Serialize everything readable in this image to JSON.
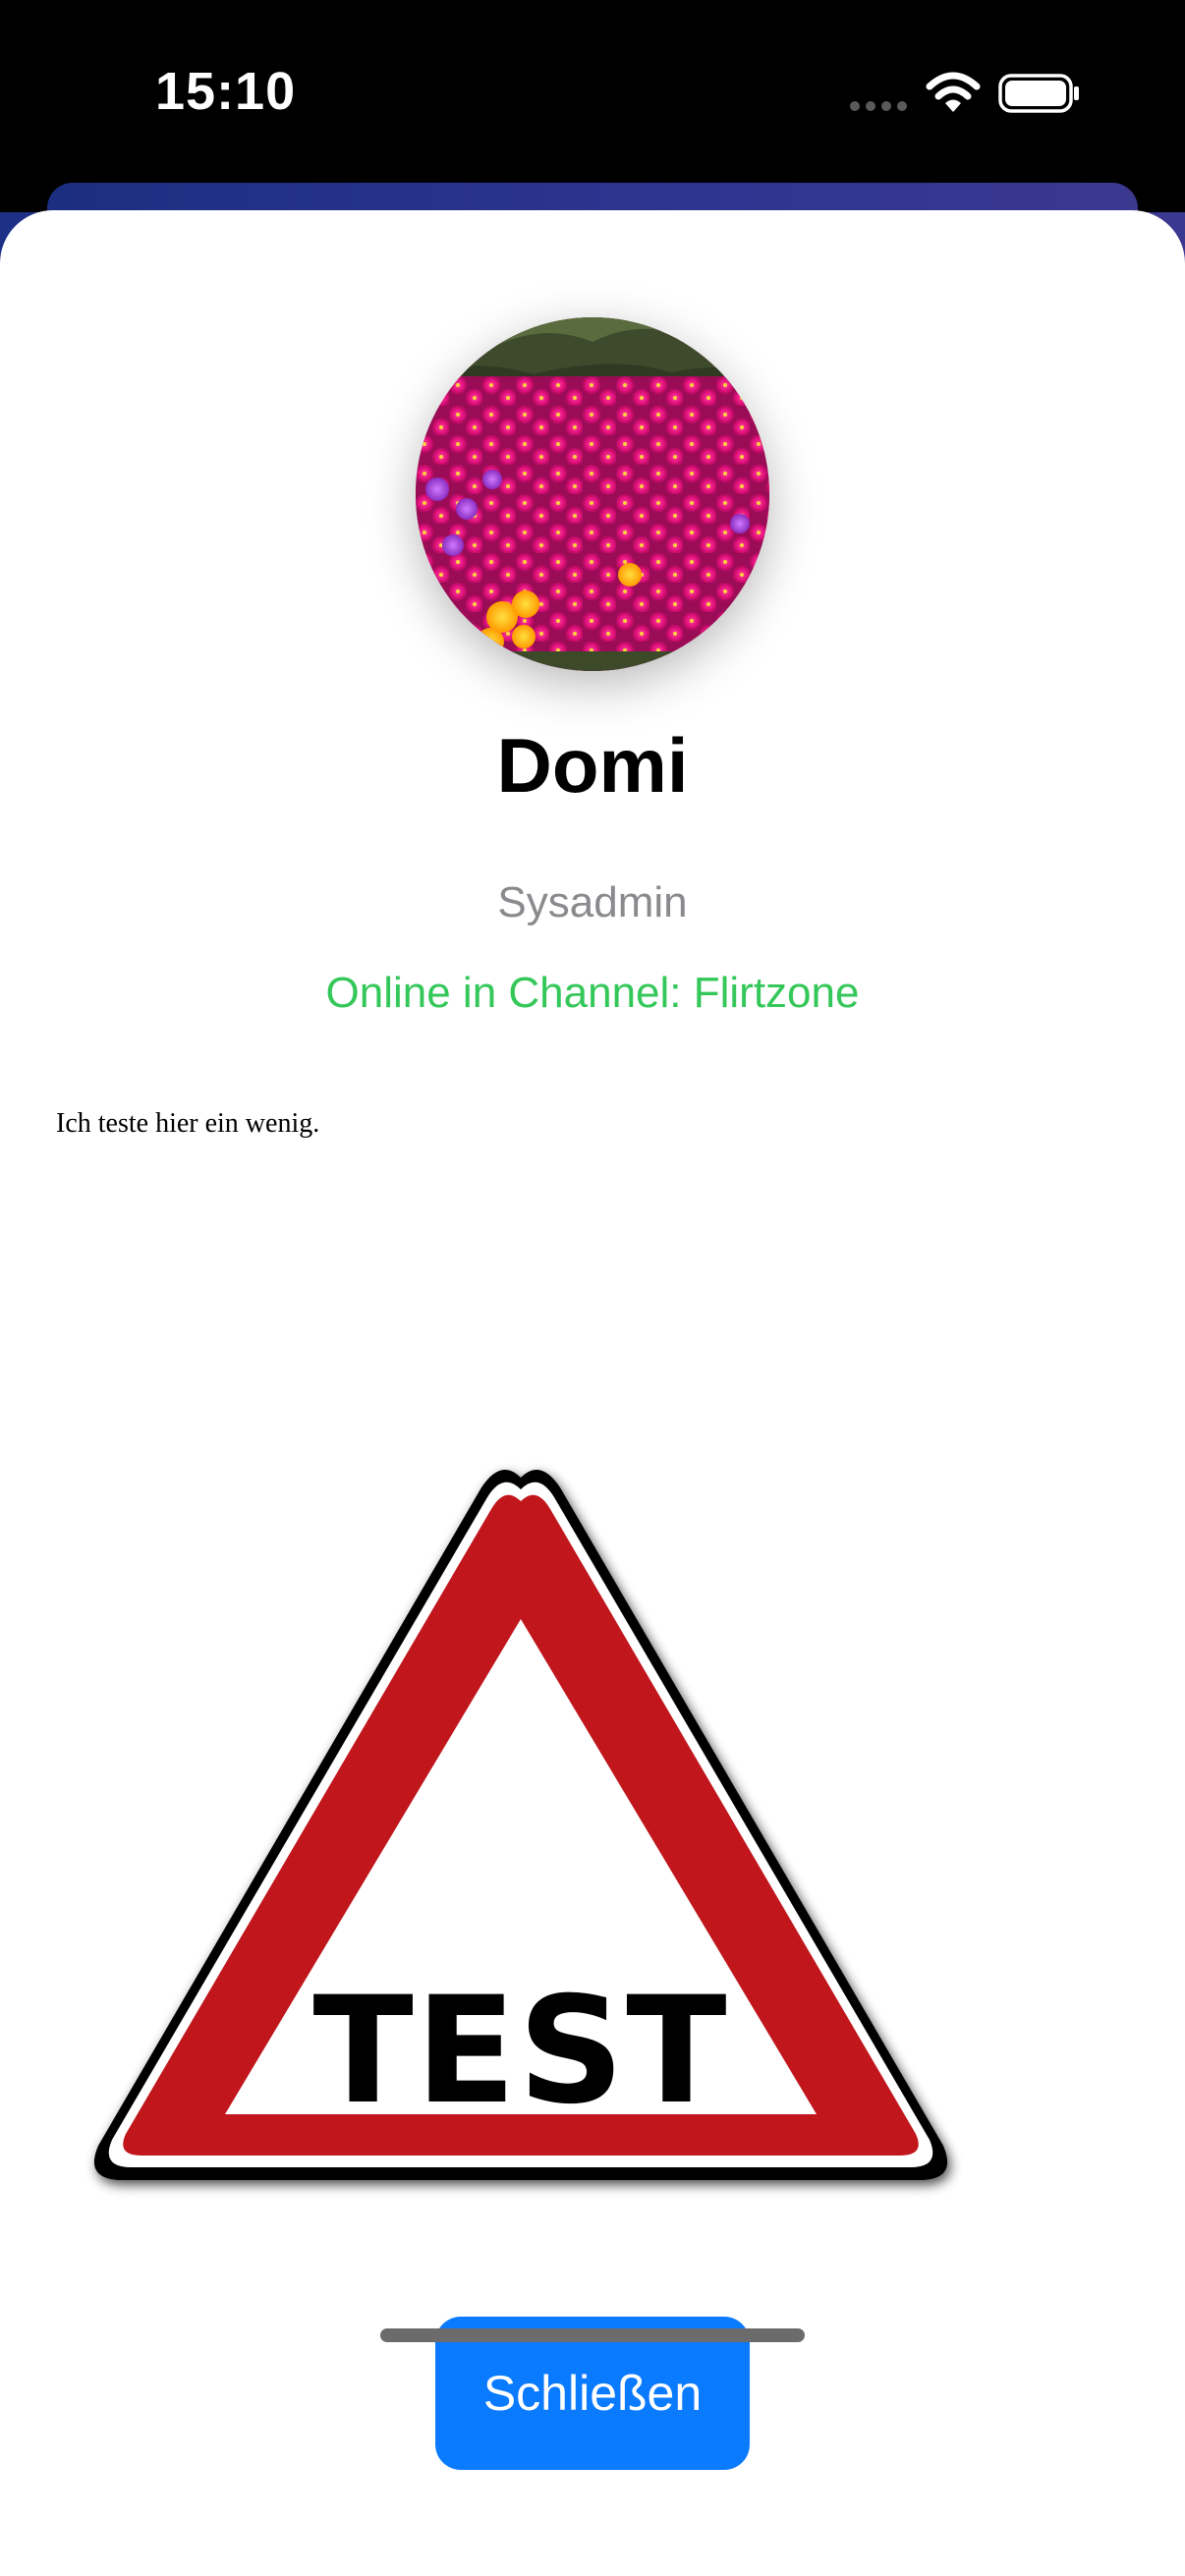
{
  "status_bar": {
    "time": "15:10",
    "icons": [
      "cellular-signal-icon",
      "wifi-icon",
      "battery-icon"
    ]
  },
  "profile": {
    "name": "Domi",
    "role": "Sysadmin",
    "status": "Online in Channel: Flirtzone",
    "bio": "Ich teste hier ein wenig.",
    "avatar": "profile-photo-flowers"
  },
  "image": {
    "sign_text": "TEST",
    "type": "warning-triangle-sign"
  },
  "actions": {
    "close_label": "Schließen"
  },
  "colors": {
    "accent": "#0a7aff",
    "status_online": "#34c759",
    "secondary_text": "#8a8a8e",
    "sign_red": "#c0141c",
    "header_gradient_start": "#1c2e80",
    "header_gradient_end": "#3b3890"
  }
}
